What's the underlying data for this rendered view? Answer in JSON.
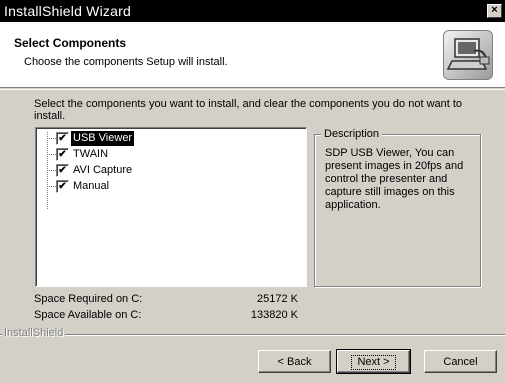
{
  "window": {
    "title": "InstallShield Wizard",
    "close_glyph": "×"
  },
  "header": {
    "title": "Select Components",
    "subtitle": "Choose the components Setup will install.",
    "icon": "installer-computer-icon"
  },
  "instructions": "Select the components you want to install, and clear the components you do not want to install.",
  "components": [
    {
      "label": "USB Viewer",
      "checked": true,
      "selected": true
    },
    {
      "label": "TWAIN",
      "checked": true,
      "selected": false
    },
    {
      "label": "AVI Capture",
      "checked": true,
      "selected": false
    },
    {
      "label": "Manual",
      "checked": true,
      "selected": false
    }
  ],
  "check_glyph": "✔",
  "description": {
    "legend": "Description",
    "text": "SDP USB Viewer, You can present images in 20fps and control the presenter and capture still images on this application."
  },
  "space": {
    "required_label": "Space Required on  C:",
    "required_value": "25172 K",
    "available_label": "Space Available on  C:",
    "available_value": "133820 K"
  },
  "brand": "InstallShield",
  "buttons": {
    "back": "< Back",
    "next": "Next >",
    "cancel": "Cancel"
  }
}
